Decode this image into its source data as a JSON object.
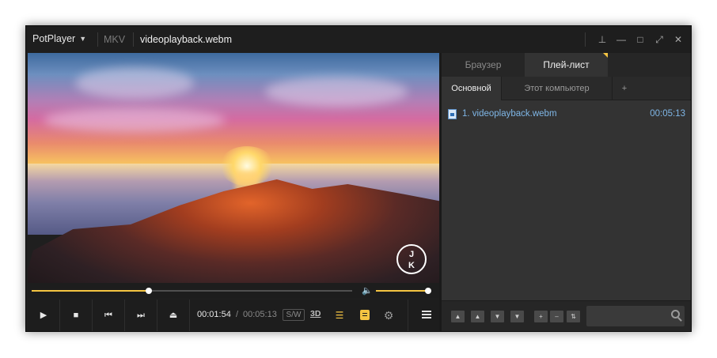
{
  "titlebar": {
    "app_name": "PotPlayer",
    "container": "MKV",
    "title": "videoplayback.webm",
    "buttons": {
      "pin": "⊥",
      "minimize": "—",
      "maximize": "□",
      "fullscreen": "⤢",
      "close": "✕"
    }
  },
  "player": {
    "seek_progress": 0.366,
    "volume_level": 1.0,
    "current_time": "00:01:54",
    "separator": "/",
    "total_time": "00:05:13",
    "sw_label": "S/W",
    "three_d_label": "3D",
    "watermark": {
      "top": "J",
      "bottom": "K"
    }
  },
  "panel": {
    "tabs": [
      "Браузер",
      "Плей-лист"
    ],
    "subtabs": [
      "Основной",
      "Этот компьютер",
      "+"
    ],
    "items": [
      {
        "name": "1. videoplayback.webm",
        "duration": "00:05:13"
      }
    ]
  },
  "icons": {
    "play": "play-icon",
    "stop": "stop-icon",
    "prev": "previous-icon",
    "next": "next-icon",
    "eject": "eject-icon",
    "accent": "#f5c542"
  }
}
